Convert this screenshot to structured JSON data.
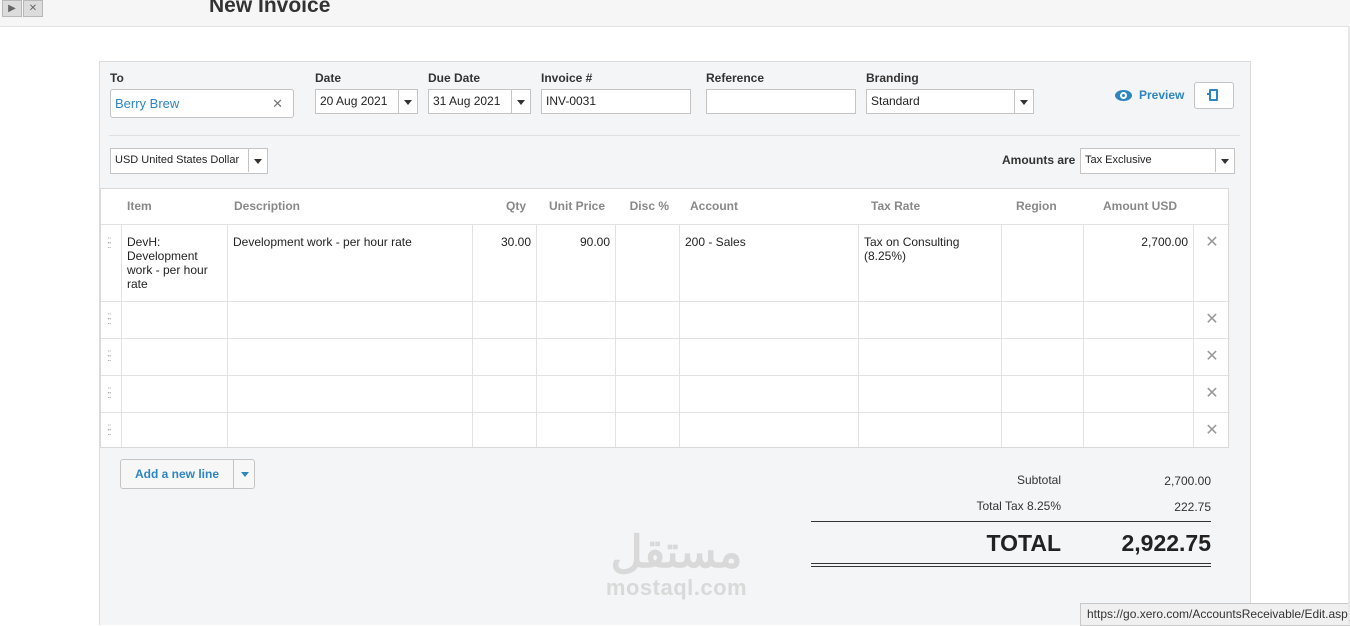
{
  "window": {
    "title": "New Invoice"
  },
  "form": {
    "to_label": "To",
    "to_value": "Berry Brew",
    "date_label": "Date",
    "date_value": "20 Aug 2021",
    "due_label": "Due Date",
    "due_value": "31 Aug 2021",
    "invoice_label": "Invoice #",
    "invoice_value": "INV-0031",
    "reference_label": "Reference",
    "reference_value": "",
    "branding_label": "Branding",
    "branding_value": "Standard",
    "preview_label": "Preview",
    "currency_value": "USD United States Dollar",
    "amounts_label": "Amounts are",
    "amounts_value": "Tax Exclusive"
  },
  "table": {
    "headers": [
      "Item",
      "Description",
      "Qty",
      "Unit Price",
      "Disc %",
      "Account",
      "Tax Rate",
      "Region",
      "Amount USD"
    ],
    "rows": [
      {
        "item": "DevH: Development work - per hour rate",
        "description": "Development work - per hour rate",
        "qty": "30.00",
        "unit_price": "90.00",
        "disc": "",
        "account": "200 - Sales",
        "tax_rate": "Tax on Consulting (8.25%)",
        "region": "",
        "amount": "2,700.00"
      }
    ]
  },
  "actions": {
    "add_line": "Add a new line"
  },
  "totals": {
    "subtotal_label": "Subtotal",
    "subtotal_value": "2,700.00",
    "tax_label": "Total Tax 8.25%",
    "tax_value": "222.75",
    "total_label": "TOTAL",
    "total_value": "2,922.75"
  },
  "watermark": {
    "arabic": "مستقل",
    "latin": "mostaql.com"
  },
  "status_bar": {
    "url": "https://go.xero.com/AccountsReceivable/Edit.aspx"
  },
  "icons": {
    "clear": "close-icon",
    "preview": "eye-icon",
    "copy": "copy-icon",
    "grip": "drag-handle-icon",
    "delete": "close-icon",
    "dropdown": "caret-down-icon"
  },
  "colors": {
    "accent": "#2e86c1",
    "panel": "#f4f5f6",
    "header_text": "#888888"
  }
}
